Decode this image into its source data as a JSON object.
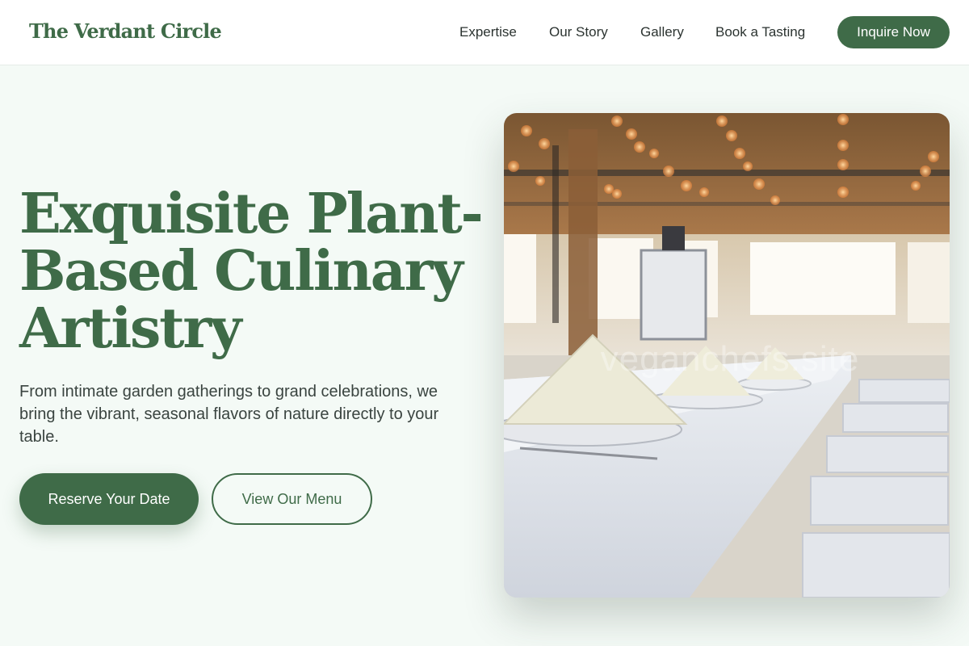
{
  "header": {
    "brand": "The Verdant Circle",
    "nav": [
      "Expertise",
      "Our Story",
      "Gallery",
      "Book a Tasting"
    ],
    "cta": "Inquire Now"
  },
  "hero": {
    "title_lines": [
      "Exquisite Plant-",
      "Based Culinary",
      "Artistry"
    ],
    "description": "From intimate garden gatherings to grand celebrations, we bring the vibrant, seasonal flavors of nature directly to your table.",
    "primary_button": "Reserve Your Date",
    "secondary_button": "View Our Menu",
    "image": {
      "subject": "banquet-table-photo",
      "watermark": "veganchefs.site"
    }
  },
  "colors": {
    "brand_green": "#3f6b48",
    "page_background": "#f4faf6",
    "header_background": "#ffffff"
  }
}
